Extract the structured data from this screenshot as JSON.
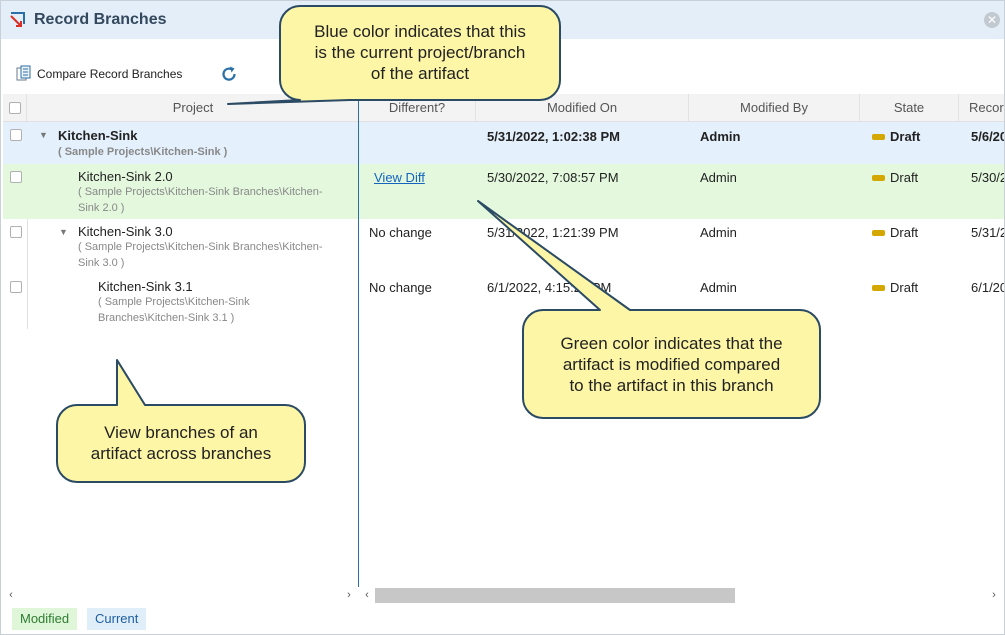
{
  "window": {
    "title": "Record Branches",
    "close_icon": "close-icon",
    "title_icon": "branch-icon"
  },
  "toolbar": {
    "compare_label": "Compare Record Branches",
    "compare_icon": "compare-document-icon",
    "refresh_icon": "refresh-icon"
  },
  "columns": {
    "project": "Project",
    "different": "Different?",
    "modified_on": "Modified On",
    "modified_by": "Modified By",
    "state": "State",
    "record": "Recor"
  },
  "rows": [
    {
      "name": "Kitchen-Sink",
      "path_lines": [
        "( Sample Projects\\Kitchen-Sink )"
      ],
      "different": "",
      "modified_on": "5/31/2022, 1:02:38 PM",
      "modified_by": "Admin",
      "state": "Draft",
      "record": "5/6/20"
    },
    {
      "name": "Kitchen-Sink 2.0",
      "path_lines": [
        "( Sample Projects\\Kitchen-Sink Branches\\Kitchen-",
        "Sink 2.0 )"
      ],
      "different": "View Diff",
      "modified_on": "5/30/2022, 7:08:57 PM",
      "modified_by": "Admin",
      "state": "Draft",
      "record": "5/30/2"
    },
    {
      "name": "Kitchen-Sink 3.0",
      "path_lines": [
        "( Sample Projects\\Kitchen-Sink Branches\\Kitchen-",
        "Sink 3.0 )"
      ],
      "different": "No change",
      "modified_on": "5/31/2022, 1:21:39 PM",
      "modified_by": "Admin",
      "state": "Draft",
      "record": "5/31/2"
    },
    {
      "name": "Kitchen-Sink 3.1",
      "path_lines": [
        "( Sample Projects\\Kitchen-Sink",
        "Branches\\Kitchen-Sink 3.1 )"
      ],
      "different": "No change",
      "modified_on": "6/1/2022, 4:15:21 PM",
      "modified_by": "Admin",
      "state": "Draft",
      "record": "6/1/20"
    }
  ],
  "legend": {
    "modified": "Modified",
    "current": "Current"
  },
  "callouts": {
    "blue": [
      "Blue color indicates that this",
      "is the current project/branch",
      "of the artifact"
    ],
    "green": [
      "Green color indicates that the",
      "artifact is modified compared",
      "to the artifact in this branch"
    ],
    "branches": [
      "View branches of an",
      "artifact across branches"
    ]
  },
  "colors": {
    "current": "#e4f0fb",
    "modified": "#e3f8dd",
    "callout_fill": "#fdf6a7",
    "callout_stroke": "#2b4a63",
    "draft_badge": "#d4a800",
    "link": "#1565c0"
  }
}
